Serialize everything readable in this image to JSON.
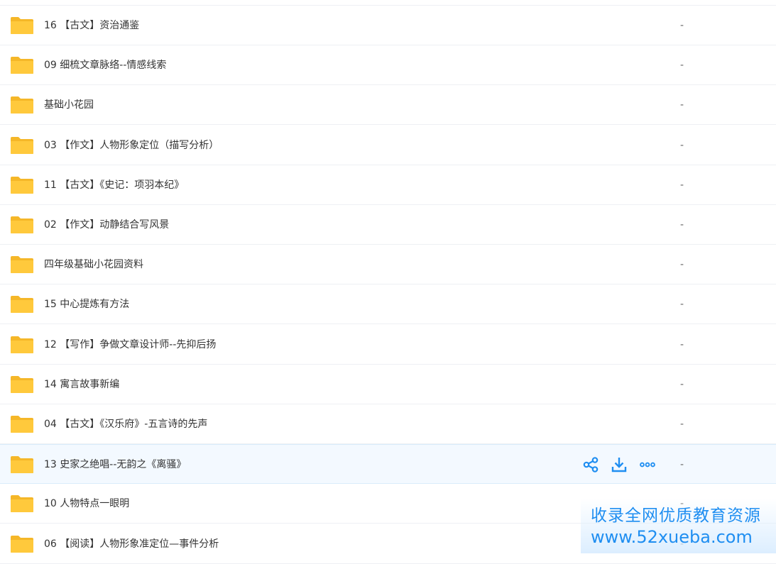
{
  "files": [
    {
      "name": "16 【古文】资治通鉴",
      "size": "-"
    },
    {
      "name": "09 细梳文章脉络--情感线索",
      "size": "-"
    },
    {
      "name": "基础小花园",
      "size": "-"
    },
    {
      "name": "03 【作文】人物形象定位（描写分析）",
      "size": "-"
    },
    {
      "name": "11 【古文】《史记：项羽本纪》",
      "size": "-"
    },
    {
      "name": "02 【作文】动静结合写风景",
      "size": "-"
    },
    {
      "name": "四年级基础小花园资料",
      "size": "-"
    },
    {
      "name": "15 中心提炼有方法",
      "size": "-"
    },
    {
      "name": "12 【写作】争做文章设计师--先抑后扬",
      "size": "-"
    },
    {
      "name": "14 寓言故事新编",
      "size": "-"
    },
    {
      "name": "04 【古文】《汉乐府》-五言诗的先声",
      "size": "-"
    },
    {
      "name": "13 史家之绝唱--无韵之《离骚》",
      "size": "-"
    },
    {
      "name": "10 人物特点一眼明",
      "size": "-"
    },
    {
      "name": "06 【阅读】人物形象准定位—事件分析",
      "size": "-"
    }
  ],
  "hovered_row": 11,
  "row_actions": [
    "share-icon",
    "download-icon",
    "more-icon"
  ],
  "colors": {
    "folder": "#ffc93c",
    "folder_tab": "#f5b728",
    "accent": "#1f8ef1",
    "hover_bg": "#f3f9ff"
  },
  "watermark": {
    "line1": "收录全网优质教育资源",
    "line2": "www.52xueba.com"
  }
}
